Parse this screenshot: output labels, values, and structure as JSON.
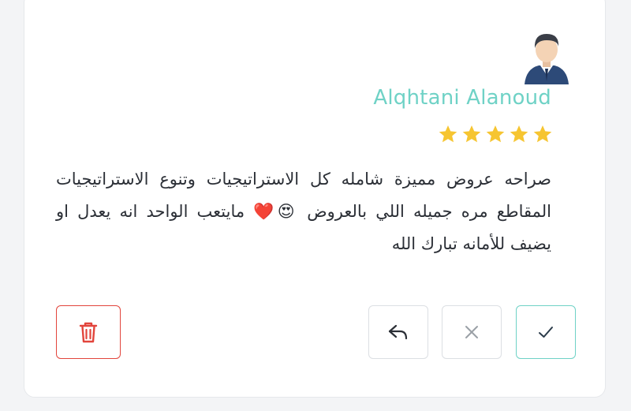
{
  "review": {
    "author": "Alqhtani Alanoud",
    "rating": 5,
    "rating_max": 5,
    "text": "صراحه عروض مميزة شامله كل الاستراتيجيات وتنوع الاستراتيجيات المقاطع مره جميله اللي بالعروض 😍❤️ مايتعب الواحد انه يعدل او يضيف للأمانه تبارك الله"
  },
  "icons": {
    "avatar": "user-avatar-icon",
    "star": "star-icon",
    "delete": "trash-icon",
    "reply": "reply-arrow-icon",
    "reject": "close-icon",
    "accept": "check-icon"
  },
  "colors": {
    "accent": "#6fd2c6",
    "star": "#f6c531",
    "danger": "#e2453c",
    "border": "#dcdfe3"
  }
}
